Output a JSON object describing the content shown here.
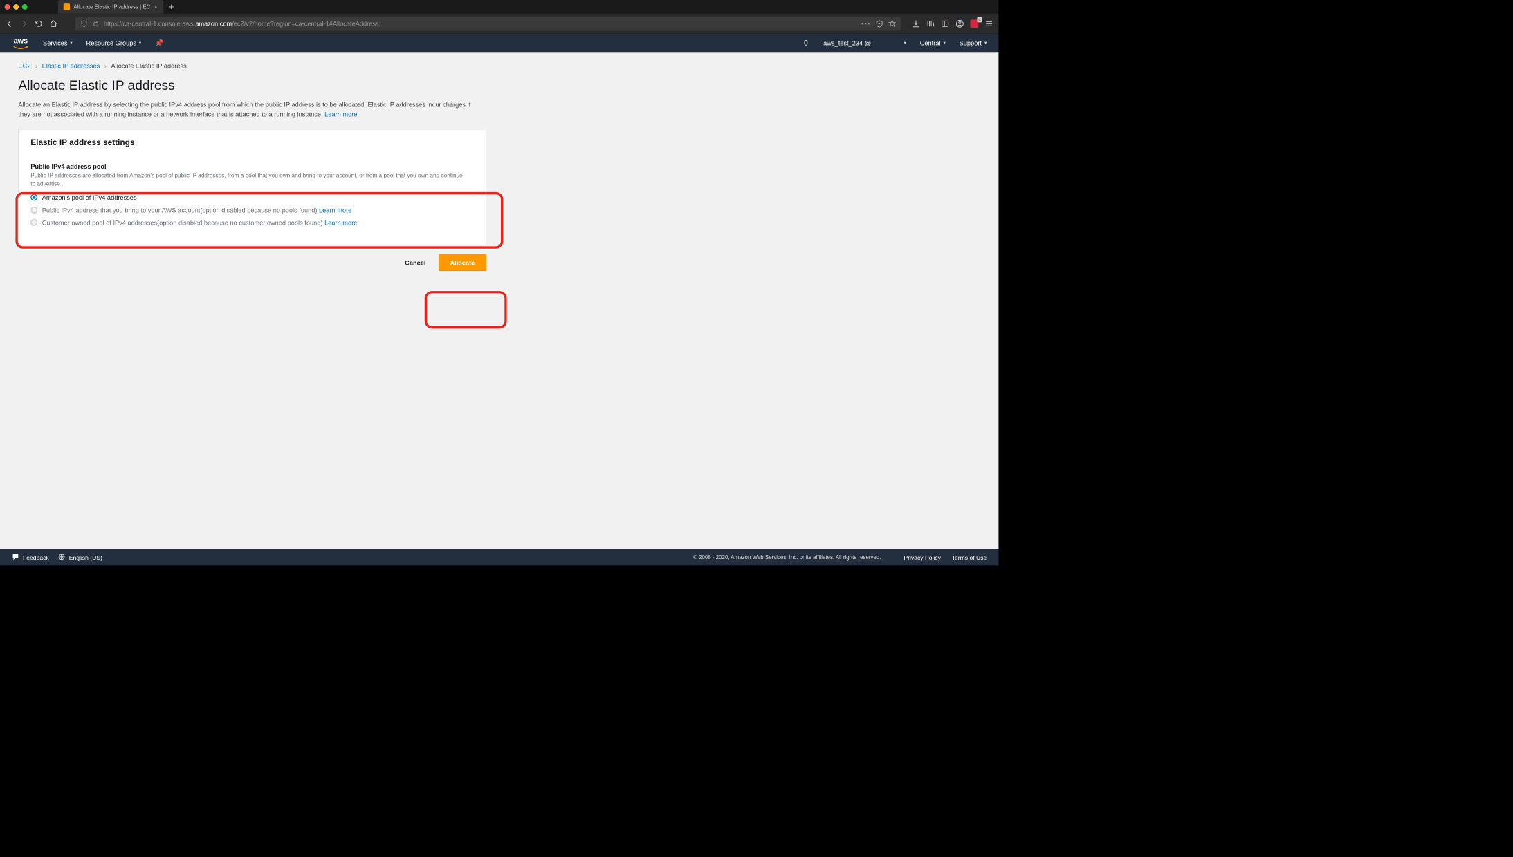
{
  "browser": {
    "tab_title": "Allocate Elastic IP address | EC",
    "url_prefix": "https://ca-central-1.console.aws.",
    "url_host": "amazon.com",
    "url_suffix": "/ec2/v2/home?region=ca-central-1#AllocateAddress:",
    "badge_count": "4"
  },
  "nav": {
    "services": "Services",
    "resource_groups": "Resource Groups",
    "account": "aws_test_234 @",
    "region": "Central",
    "support": "Support"
  },
  "breadcrumb": {
    "lvl1": "EC2",
    "lvl2": "Elastic IP addresses",
    "lvl3": "Allocate Elastic IP address"
  },
  "page": {
    "title": "Allocate Elastic IP address",
    "desc": "Allocate an Elastic IP address by selecting the public IPv4 address pool from which the public IP address is to be allocated. Elastic IP addresses incur charges if they are not associated with a running instance or a network interface that is attached to a running instance. ",
    "learn_more": "Learn more"
  },
  "panel": {
    "header": "Elastic IP address settings",
    "field_title": "Public IPv4 address pool",
    "field_desc": "Public IP addresses are allocated from Amazon's pool of public IP addresses, from a pool that you own and bring to your account, or from a pool that you own and continue to advertise..",
    "radios": {
      "r1": "Amazon's pool of IPv4 addresses",
      "r2": "Public IPv4 address that you bring to your AWS account(option disabled because no pools found) ",
      "r3": "Customer owned pool of IPv4 addresses(option disabled because no customer owned pools found) ",
      "learn_more": "Learn more"
    }
  },
  "actions": {
    "cancel": "Cancel",
    "allocate": "Allocate"
  },
  "footer": {
    "feedback": "Feedback",
    "language": "English (US)",
    "copyright": "© 2008 - 2020, Amazon Web Services, Inc. or its affiliates. All rights reserved.",
    "privacy": "Privacy Policy",
    "terms": "Terms of Use"
  }
}
